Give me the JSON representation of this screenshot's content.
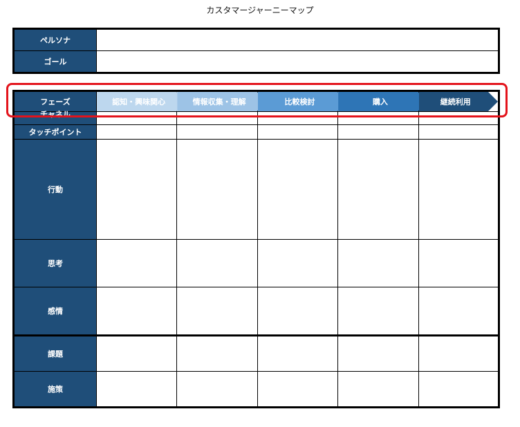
{
  "title": "カスタマージャーニーマップ",
  "persona_section": {
    "rows": [
      {
        "label": "ペルソナ",
        "value": ""
      },
      {
        "label": "ゴール",
        "value": ""
      }
    ]
  },
  "journey": {
    "phase_label": "フェーズ",
    "phases": [
      {
        "label": "認知・興味関心",
        "color": "#bdd7ee"
      },
      {
        "label": "情報収集・理解",
        "color": "#9dc3e6"
      },
      {
        "label": "比較検討",
        "color": "#5b9bd5"
      },
      {
        "label": "購入",
        "color": "#2e75b6"
      },
      {
        "label": "継続利用",
        "color": "#1f4e79"
      }
    ],
    "rows": [
      {
        "label": "チャネル"
      },
      {
        "label": "タッチポイント"
      },
      {
        "label": "行動"
      },
      {
        "label": "思考"
      },
      {
        "label": "感情"
      },
      {
        "label": "課題"
      },
      {
        "label": "施策"
      }
    ]
  },
  "colors": {
    "header_bg": "#1f4e79",
    "highlight": "#e3131b"
  }
}
